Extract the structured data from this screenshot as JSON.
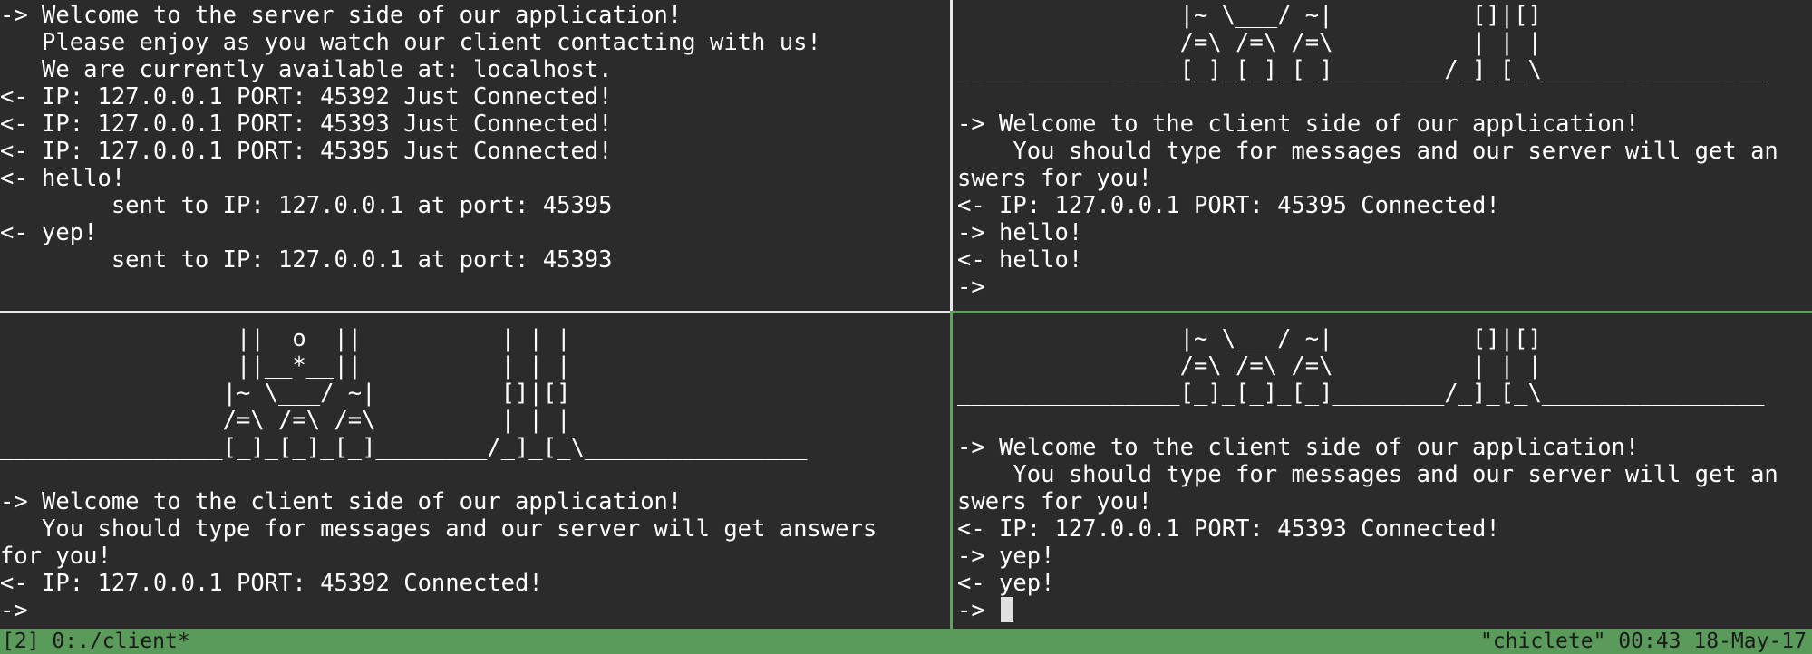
{
  "panes": {
    "server": {
      "lines": [
        "-> Welcome to the server side of our application!",
        "   Please enjoy as you watch our client contacting with us!",
        "   We are currently available at: localhost.",
        "<- IP: 127.0.0.1 PORT: 45392 Just Connected!",
        "<- IP: 127.0.0.1 PORT: 45393 Just Connected!",
        "<- IP: 127.0.0.1 PORT: 45395 Just Connected!",
        "<- hello!",
        "        sent to IP: 127.0.0.1 at port: 45395",
        "<- yep!",
        "        sent to IP: 127.0.0.1 at port: 45393"
      ]
    },
    "client_top_right": {
      "lines": [
        "                |~ \\___/ ~|          []|[]",
        "                /=\\ /=\\ /=\\          | | |",
        "________________[_]_[_]_[_]________/_]_[_\\________________",
        "",
        "-> Welcome to the client side of our application!",
        "    You should type for messages and our server will get an",
        "swers for you!",
        "<- IP: 127.0.0.1 PORT: 45395 Connected!",
        "-> hello!",
        "<- hello!",
        "->"
      ]
    },
    "client_bottom_left": {
      "lines": [
        "                 ||  o  ||          | | |",
        "                 ||__*__||          | | |",
        "                |~ \\___/ ~|         []|[]",
        "                /=\\ /=\\ /=\\         | | |",
        "________________[_]_[_]_[_]________/_]_[_\\________________",
        "",
        "-> Welcome to the client side of our application!",
        "   You should type for messages and our server will get answers",
        "for you!",
        "<- IP: 127.0.0.1 PORT: 45392 Connected!",
        "->"
      ]
    },
    "client_bottom_right": {
      "lines": [
        "                |~ \\___/ ~|          []|[]",
        "                /=\\ /=\\ /=\\          | | |",
        "________________[_]_[_]_[_]________/_]_[_\\________________",
        "",
        "-> Welcome to the client side of our application!",
        "    You should type for messages and our server will get an",
        "swers for you!",
        "<- IP: 127.0.0.1 PORT: 45393 Connected!",
        "-> yep!",
        "<- yep!",
        "->"
      ]
    }
  },
  "status_bar": {
    "left": "[2] 0:./client*",
    "right": "\"chiclete\" 00:43 18-May-17"
  },
  "colors": {
    "background": "#2b2b2b",
    "text": "#ffffff",
    "status_bar": "#5a9a5a",
    "active_border": "#5fa35f",
    "inactive_border": "#e8e8e8"
  }
}
